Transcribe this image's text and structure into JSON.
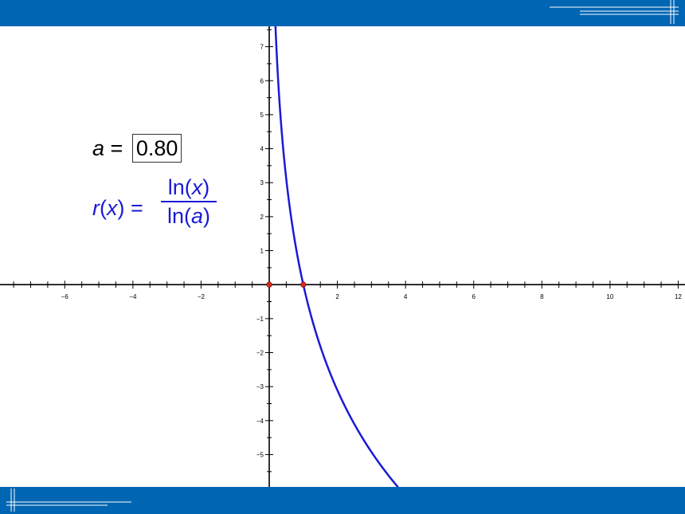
{
  "colors": {
    "band": "#0065b3",
    "curve": "#1a1ad6",
    "point": "#d42a1f",
    "axis": "#000000"
  },
  "formula": {
    "a_label": "a",
    "equals": "=",
    "a_value": "0.80",
    "lhs_r": "r",
    "lhs_open": "(",
    "lhs_x": "x",
    "lhs_close": ")",
    "lhs_eq": "=",
    "num_ln": "ln(",
    "num_x": "x",
    "num_close": ")",
    "den_ln": "ln(",
    "den_a": "a",
    "den_close": ")"
  },
  "chart_data": {
    "type": "line",
    "function": "r(x) = ln(x)/ln(a)",
    "a": 0.8,
    "xlim": [
      -7.9,
      12.2
    ],
    "ylim": [
      -5.95,
      7.6
    ],
    "x_ticks": [
      -6,
      -4,
      -2,
      2,
      4,
      6,
      8,
      10,
      12
    ],
    "x_tick_labels": [
      "−6",
      "−4",
      "−2",
      "2",
      "4",
      "6",
      "8",
      "10",
      "12"
    ],
    "y_ticks": [
      -5,
      -4,
      -3,
      -2,
      -1,
      1,
      2,
      3,
      4,
      5,
      6,
      7
    ],
    "y_tick_labels": [
      "−5",
      "−4",
      "−3",
      "−2",
      "−1",
      "1",
      "2",
      "3",
      "4",
      "5",
      "6",
      "7"
    ],
    "minor_step": 0.5,
    "grid": false,
    "points": [
      {
        "x": 0,
        "y": 0
      },
      {
        "x": 1,
        "y": 0
      }
    ]
  }
}
